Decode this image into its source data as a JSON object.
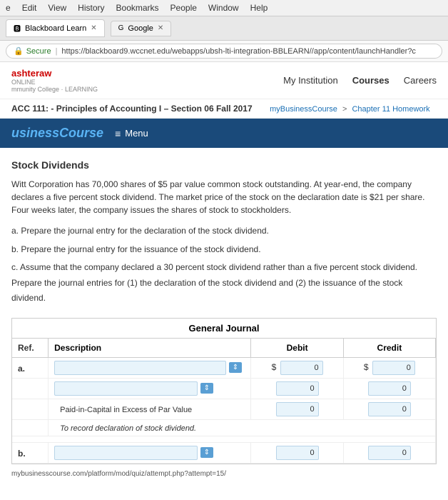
{
  "browser": {
    "menu_items": [
      "e",
      "Edit",
      "View",
      "History",
      "Bookmarks",
      "People",
      "Window",
      "Help"
    ],
    "tab1_label": "Blackboard Learn",
    "tab2_label": "Google",
    "address_secure_label": "Secure",
    "address_url": "https://blackboard9.wccnet.edu/webapps/ubsh-lti-integration-BBLEARN//app/content/launchHandler?c"
  },
  "site": {
    "logo_brand": "ashteraw",
    "logo_sub1": "ONLINE",
    "logo_sub2": "mmunity College · LEARNING",
    "nav_myinstitution": "My Institution",
    "nav_courses": "Courses",
    "nav_careers": "Careers"
  },
  "breadcrumb": {
    "course": "ACC 111: - Principles of Accounting I – Section 06 Fall 2017",
    "path1": "myBusinessCourse",
    "sep": ">",
    "path2": "Chapter 11 Homework"
  },
  "course_bar": {
    "name": "usinessCourse",
    "menu_label": "Menu"
  },
  "main": {
    "section_title": "Stock Dividends",
    "description": "Witt Corporation has 70,000 shares of $5 par value common stock outstanding. At year-end, the company declares a five percent stock dividend. The market price of the stock on the declaration date is $21 per share. Four weeks later, the company issues the shares of stock to stockholders.",
    "instruction_a": "a. Prepare the journal entry for the declaration of the stock dividend.",
    "instruction_b": "b. Prepare the journal entry for the issuance of the stock dividend.",
    "instruction_c": "c. Assume that the company declared a 30 percent stock dividend rather than a five percent stock dividend. Prepare the journal entries for (1) the declaration of the stock dividend and (2) the issuance of the stock dividend.",
    "table_title": "General Journal",
    "col_ref": "Ref.",
    "col_desc": "Description",
    "col_debit": "Debit",
    "col_credit": "Credit",
    "row_a_ref": "a.",
    "row_a_desc_placeholder": "",
    "row_a_debit": "0",
    "row_a_credit": "0",
    "row_a2_debit": "0",
    "row_a2_credit": "0",
    "row_a3_label": "Paid-in-Capital in Excess of Par Value",
    "row_a3_debit": "0",
    "row_a3_credit": "0",
    "row_a_note": "To record declaration of stock dividend.",
    "row_b_ref": "b.",
    "row_b_debit": "0",
    "row_b_credit": "0"
  }
}
